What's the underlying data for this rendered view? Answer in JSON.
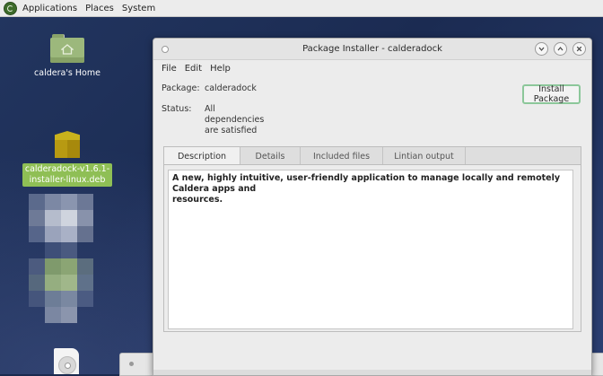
{
  "top_panel": {
    "menus": [
      "Applications",
      "Places",
      "System"
    ]
  },
  "desktop": {
    "home_label": "caldera's Home",
    "package_file_label_line1": "calderadock-v1.6.1-",
    "package_file_label_line2": "installer-linux.deb"
  },
  "window": {
    "title": "Package Installer - calderadock",
    "menu": [
      "File",
      "Edit",
      "Help"
    ],
    "package_label": "Package:",
    "package_value": "calderadock",
    "status_label": "Status:",
    "status_lines": [
      "All",
      "dependencies",
      "are satisfied"
    ],
    "install_button": "Install Package",
    "tabs": [
      "Description",
      "Details",
      "Included files",
      "Lintian output"
    ],
    "active_tab": "Description",
    "description_line1": "A new, highly intuitive, user-friendly application to manage locally and remotely Caldera apps and",
    "description_line2": "resources."
  },
  "colors": {
    "accent_green": "#8cc79a",
    "selection_green": "#8fbf55",
    "desktop_blue": "#1b2b52"
  },
  "icons": [
    "mint-menu-icon",
    "home-folder-icon",
    "deb-package-icon",
    "disc-icon",
    "window-menu-icon",
    "minimize-icon",
    "maximize-icon",
    "close-icon"
  ]
}
